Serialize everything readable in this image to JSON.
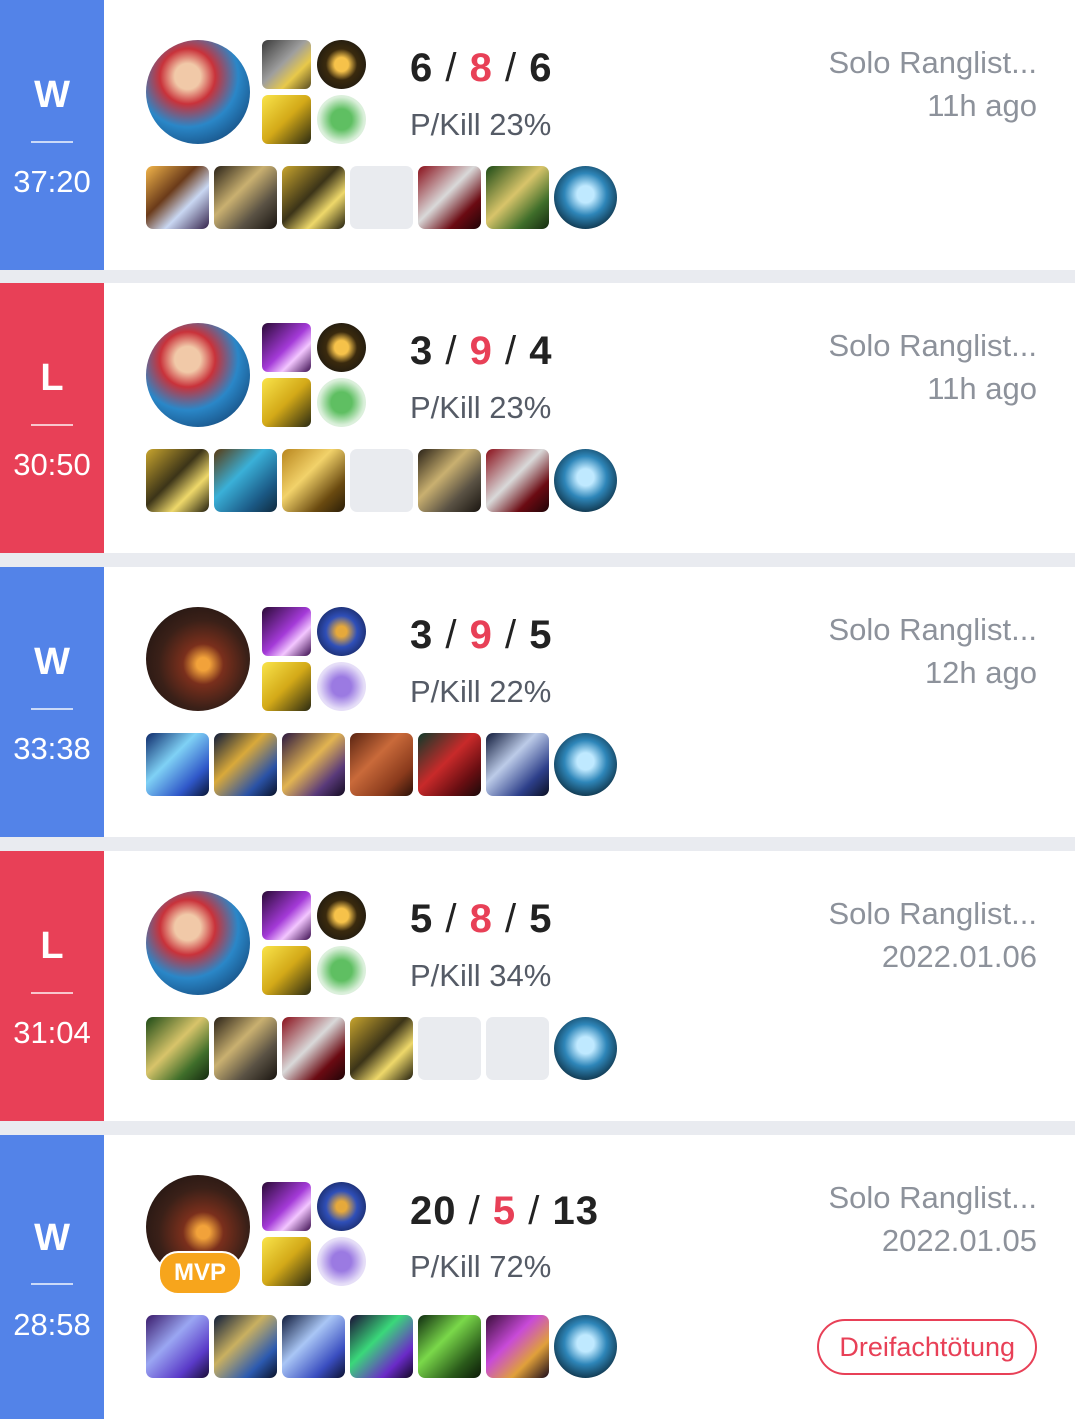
{
  "matches": [
    {
      "result": "W",
      "duration": "37:20",
      "outcome": "win",
      "kills": "6",
      "deaths": "8",
      "assists": "6",
      "pkill": "P/Kill 23%",
      "queue": "Solo Ranglist...",
      "time": "11h ago"
    },
    {
      "result": "L",
      "duration": "30:50",
      "outcome": "loss",
      "kills": "3",
      "deaths": "9",
      "assists": "4",
      "pkill": "P/Kill 23%",
      "queue": "Solo Ranglist...",
      "time": "11h ago"
    },
    {
      "result": "W",
      "duration": "33:38",
      "outcome": "win",
      "kills": "3",
      "deaths": "9",
      "assists": "5",
      "pkill": "P/Kill 22%",
      "queue": "Solo Ranglist...",
      "time": "12h ago"
    },
    {
      "result": "L",
      "duration": "31:04",
      "outcome": "loss",
      "kills": "5",
      "deaths": "8",
      "assists": "5",
      "pkill": "P/Kill 34%",
      "queue": "Solo Ranglist...",
      "time": "2022.01.06"
    },
    {
      "result": "W",
      "duration": "28:58",
      "outcome": "win",
      "kills": "20",
      "deaths": "5",
      "assists": "13",
      "pkill": "P/Kill 72%",
      "queue": "Solo Ranglist...",
      "time": "2022.01.05",
      "badge": "MVP",
      "multikill": "Dreifachtötung"
    }
  ],
  "separator": "/",
  "colors": {
    "win": "#5383e8",
    "loss": "#e84057",
    "mvp": "#f7a51c"
  },
  "icons": {
    "champions": [
      "ezreal-champion-icon",
      "ezreal-champion-icon",
      "dark-champion-icon",
      "ezreal-champion-icon",
      "dark-champion-icon"
    ],
    "summoner_spells": [
      "ghost-spell-icon",
      "ignite-spell-icon",
      "flash-spell-icon"
    ],
    "runes": [
      "lethal-tempo-rune-icon",
      "resolve-rune-icon",
      "cosmic-rune-icon",
      "sorcery-rune-icon"
    ],
    "trinket": "ward-trinket-icon"
  }
}
